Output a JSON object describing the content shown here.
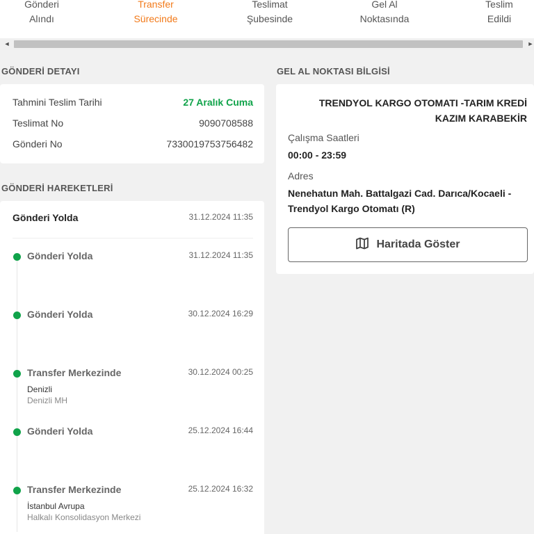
{
  "steps": [
    {
      "line1": "Gönderi",
      "line2": "Alındı",
      "active": false
    },
    {
      "line1": "Transfer",
      "line2": "Sürecinde",
      "active": true
    },
    {
      "line1": "Teslimat",
      "line2": "Şubesinde",
      "active": false
    },
    {
      "line1": "Gel Al",
      "line2": "Noktasında",
      "active": false
    },
    {
      "line1": "Teslim",
      "line2": "Edildi",
      "active": false
    }
  ],
  "scrollbar": {
    "left_arrow": "◄",
    "right_arrow": "►"
  },
  "detail": {
    "title": "GÖNDERİ DETAYI",
    "rows": [
      {
        "label": "Tahmini Teslim Tarihi",
        "value": "27 Aralık Cuma"
      },
      {
        "label": "Teslimat No",
        "value": "9090708588"
      },
      {
        "label": "Gönderi No",
        "value": "7330019753756482"
      }
    ]
  },
  "movements": {
    "title": "GÖNDERİ HAREKETLERİ",
    "latest": {
      "title": "Gönderi Yolda",
      "date": "31.12.2024 11:35"
    },
    "events": [
      {
        "title": "Gönderi Yolda",
        "date": "31.12.2024 11:35",
        "sub1": "",
        "sub2": ""
      },
      {
        "title": "Gönderi Yolda",
        "date": "30.12.2024 16:29",
        "sub1": "",
        "sub2": ""
      },
      {
        "title": "Transfer Merkezinde",
        "date": "30.12.2024 00:25",
        "sub1": "Denizli",
        "sub2": "Denizli MH"
      },
      {
        "title": "Gönderi Yolda",
        "date": "25.12.2024 16:44",
        "sub1": "",
        "sub2": ""
      },
      {
        "title": "Transfer Merkezinde",
        "date": "25.12.2024 16:32",
        "sub1": "İstanbul Avrupa",
        "sub2": "Halkalı Konsolidasyon Merkezi"
      }
    ]
  },
  "pickup": {
    "title": "GEL AL NOKTASI BİLGİSİ",
    "name": "TRENDYOL KARGO OTOMATI -TARIM KREDİ KAZIM KARABEKİR",
    "hours_label": "Çalışma Saatleri",
    "hours": "00:00 - 23:59",
    "address_label": "Adres",
    "address": "Nenehatun Mah. Battalgazi Cad. Darıca/Kocaeli - Trendyol Kargo Otomatı (R)",
    "map_button": "Haritada Göster"
  },
  "colors": {
    "accent": "#f27a1a",
    "success": "#10a34a"
  },
  "icons": {
    "map": "map-icon"
  }
}
